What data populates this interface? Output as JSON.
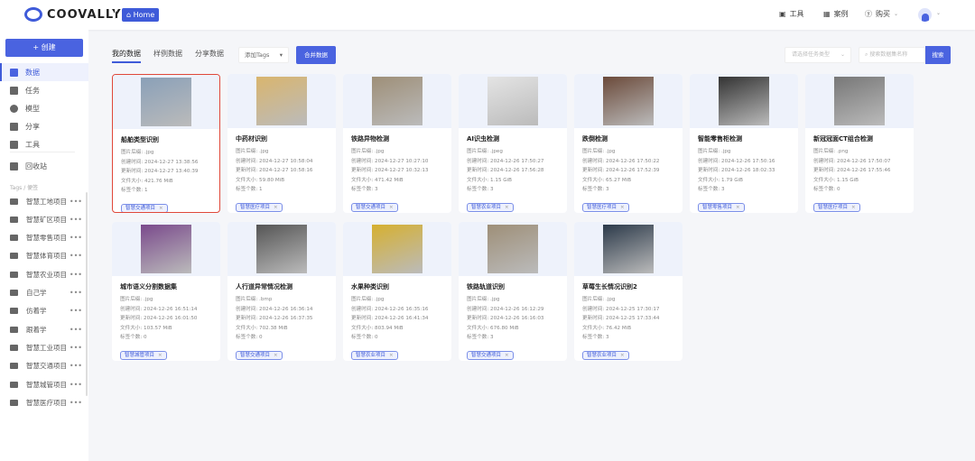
{
  "header": {
    "logo": "COOVALLY",
    "home": "Home",
    "nav": [
      "工具",
      "案例",
      "购买"
    ]
  },
  "sidebar": {
    "create": "+ 创建",
    "items": [
      "数据",
      "任务",
      "模型",
      "分享",
      "工具",
      "回收站"
    ],
    "tags_label": "Tags / 便签",
    "tags": [
      "智慧工地项目",
      "智慧矿区项目",
      "智慧零售项目",
      "智慧体育项目",
      "智慧农业项目",
      "自己学",
      "仿着学",
      "跟着学",
      "智慧工业项目",
      "智慧交通项目",
      "智慧城管项目",
      "智慧医疗项目"
    ]
  },
  "toolbar": {
    "tabs": [
      "我的数据",
      "样例数据",
      "分享数据"
    ],
    "add_tags": "添加Tags",
    "merge": "合并数据",
    "task_type_placeholder": "请选择任务类型",
    "search_placeholder": "搜索数据集名称",
    "search": "搜索"
  },
  "labels": {
    "suffix": "图片后缀: ",
    "created": "创建时间: ",
    "updated": "更新时间: ",
    "size": "文件大小: ",
    "tagcount": "标签个数: "
  },
  "cards": [
    {
      "title": "船舶类型识别",
      "suffix": ".jpg",
      "created": "2024-12-27 13:38:56",
      "updated": "2024-12-27 13:40:39",
      "size": "421.76 MiB",
      "tags": "1",
      "chip": "智慧交通项目",
      "thumb": "#8aa0b8"
    },
    {
      "title": "中药材识别",
      "suffix": ".jpg",
      "created": "2024-12-27 10:58:04",
      "updated": "2024-12-27 10:58:16",
      "size": "59.80 MiB",
      "tags": "1",
      "chip": "智慧医疗项目",
      "thumb": "#d9b56e"
    },
    {
      "title": "铁路异物检测",
      "suffix": ".jpg",
      "created": "2024-12-27 10:27:10",
      "updated": "2024-12-27 10:32:13",
      "size": "471.42 MiB",
      "tags": "3",
      "chip": "智慧交通项目",
      "thumb": "#9e8f78"
    },
    {
      "title": "AI识虫检测",
      "suffix": ".jpeg",
      "created": "2024-12-26 17:50:27",
      "updated": "2024-12-26 17:56:28",
      "size": "1.15 GiB",
      "tags": "3",
      "chip": "智慧农业项目",
      "thumb": "#e4e4e4"
    },
    {
      "title": "跌倒检测",
      "suffix": ".jpg",
      "created": "2024-12-26 17:50:22",
      "updated": "2024-12-26 17:52:39",
      "size": "65.27 MiB",
      "tags": "3",
      "chip": "智慧医疗项目",
      "thumb": "#6b4a3a"
    },
    {
      "title": "智能零售柜检测",
      "suffix": ".jpg",
      "created": "2024-12-26 17:50:16",
      "updated": "2024-12-26 18:02:33",
      "size": "1.79 GiB",
      "tags": "3",
      "chip": "智慧零售项目",
      "thumb": "#333"
    },
    {
      "title": "新冠冠面CT组合检测",
      "suffix": ".png",
      "created": "2024-12-26 17:50:07",
      "updated": "2024-12-26 17:55:46",
      "size": "1.15 GiB",
      "tags": "0",
      "chip": "智慧医疗项目",
      "thumb": "#777"
    },
    {
      "title": "城市语义分割数据集",
      "suffix": ".jpg",
      "created": "2024-12-26 16:51:14",
      "updated": "2024-12-26 16:01:50",
      "size": "103.57 MiB",
      "tags": "0",
      "chip": "智慧城管项目",
      "thumb": "#7a4a8c"
    },
    {
      "title": "人行道异常情况检测",
      "suffix": ".bmp",
      "created": "2024-12-26 16:36:14",
      "updated": "2024-12-26 16:37:35",
      "size": "702.38 MiB",
      "tags": "0",
      "chip": "智慧交通项目",
      "thumb": "#555"
    },
    {
      "title": "水果种类识别",
      "suffix": ".jpg",
      "created": "2024-12-26 16:35:16",
      "updated": "2024-12-26 16:41:34",
      "size": "803.94 MiB",
      "tags": "0",
      "chip": "智慧农业项目",
      "thumb": "#d6b030"
    },
    {
      "title": "铁路轨道识别",
      "suffix": ".jpg",
      "created": "2024-12-26 16:12:29",
      "updated": "2024-12-26 16:16:03",
      "size": "676.80 MiB",
      "tags": "3",
      "chip": "智慧交通项目",
      "thumb": "#9e8f78"
    },
    {
      "title": "草莓生长情况识别2",
      "suffix": ".jpg",
      "created": "2024-12-25 17:30:17",
      "updated": "2024-12-25 17:33:44",
      "size": "76.42 MiB",
      "tags": "3",
      "chip": "智慧农业项目",
      "thumb": "#2c3a4a"
    }
  ]
}
